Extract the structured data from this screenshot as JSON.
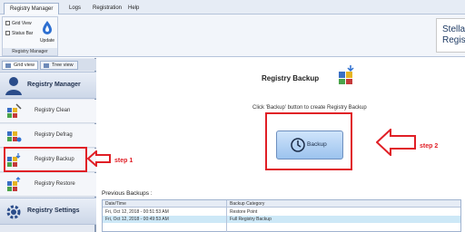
{
  "menubar": {
    "tabs": [
      "Registry Manager",
      "Logs",
      "Registration",
      "Help"
    ],
    "active_tab": "Registry Manager"
  },
  "ribbon": {
    "checkbox_grid_view": "Grid View",
    "checkbox_status_bar": "Status Bar",
    "update_label": "Update",
    "group_caption": "Registry Manager",
    "brand_line1": "Stellar",
    "brand_line2": "Regis"
  },
  "sidebar": {
    "tab_grid_view": "Grid view",
    "tab_tree_view": "Tree view",
    "section_registry_manager": "Registry Manager",
    "items": [
      {
        "label": "Registry Clean"
      },
      {
        "label": "Registry Defrag"
      },
      {
        "label": "Registry Backup"
      },
      {
        "label": "Registry Restore"
      }
    ],
    "section_registry_settings": "Registry Settings"
  },
  "main": {
    "title": "Registry Backup",
    "description": "Click 'Backup' button to create Registry Backup",
    "backup_button_label": "Backup",
    "previous_backups_label": "Previous Backups :",
    "table": {
      "columns": [
        "Date/Time",
        "Backup Category"
      ],
      "rows": [
        {
          "datetime": "Fri, Oct 12, 2018 - 00:51:53 AM",
          "category": "Restore Point"
        },
        {
          "datetime": "Fri, Oct 12, 2018 - 00:49:53 AM",
          "category": "Full Registry Backup"
        }
      ]
    }
  },
  "annotations": {
    "step1": "step 1",
    "step2": "step 2",
    "highlight_color": "#e01f26"
  },
  "colors": {
    "ribbon_bg": "#f2f5fa",
    "sidebar_bg": "#e4e9f2",
    "button_blue": "#9cc3ee",
    "selected_row": "#cde8f7"
  }
}
